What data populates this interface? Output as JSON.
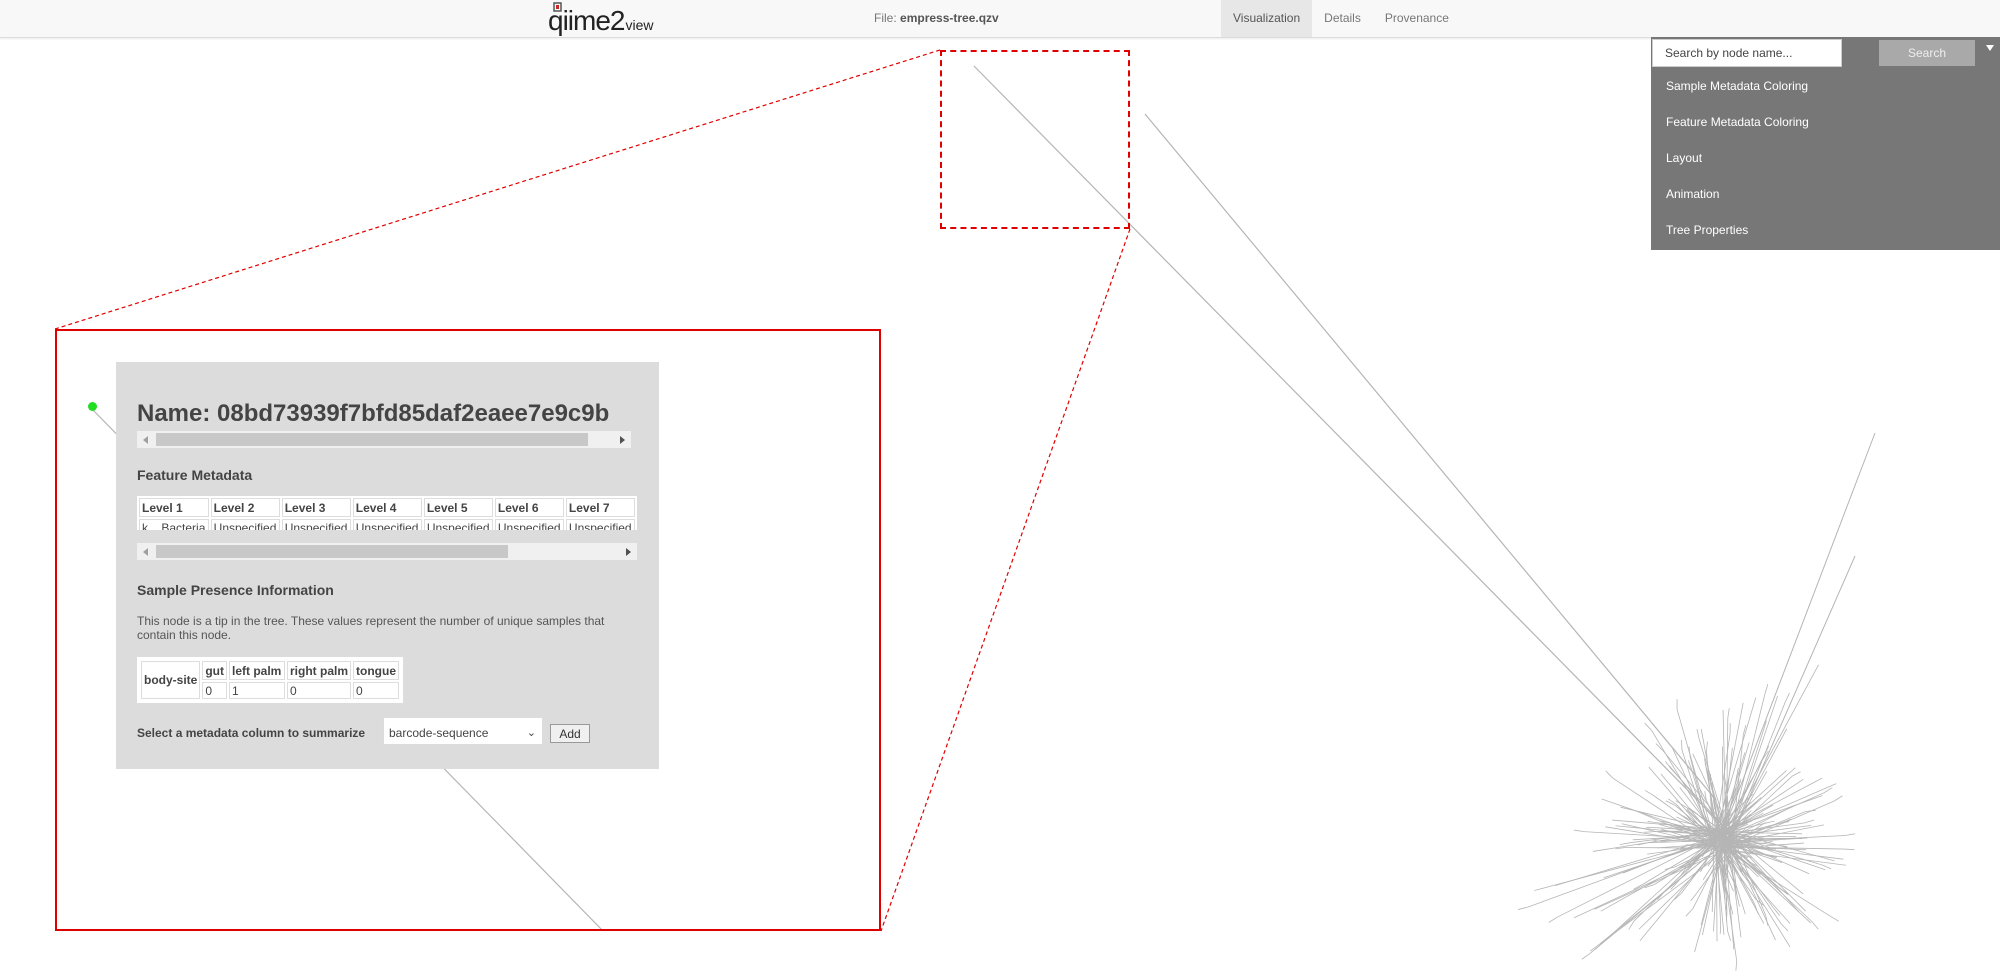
{
  "navbar": {
    "logo_main": "qiime2",
    "logo_suffix": "view",
    "file_prefix": "File:",
    "file_name": "empress-tree.qzv",
    "tabs": [
      {
        "label": "Visualization",
        "active": true
      },
      {
        "label": "Details",
        "active": false
      },
      {
        "label": "Provenance",
        "active": false
      }
    ]
  },
  "side_panel": {
    "search_placeholder": "Search by node name...",
    "search_button": "Search",
    "collapse_icon": "triangle-down-icon",
    "items": [
      "Sample Metadata Coloring",
      "Feature Metadata Coloring",
      "Layout",
      "Animation",
      "Tree Properties"
    ]
  },
  "popup": {
    "node_name": "Name: 08bd73939f7bfd85daf2eaee7e9c9b",
    "feature_metadata_title": "Feature Metadata",
    "feature_headers": [
      "Level 1",
      "Level 2",
      "Level 3",
      "Level 4",
      "Level 5",
      "Level 6",
      "Level 7"
    ],
    "feature_values": [
      "k__Bacteria",
      "Unspecified",
      "Unspecified",
      "Unspecified",
      "Unspecified",
      "Unspecified",
      "Unspecified"
    ],
    "sample_presence_title": "Sample Presence Information",
    "sample_presence_text": "This node is a tip in the tree. These values represent the number of unique samples that contain this node.",
    "sample_row_label": "body-site",
    "sample_headers": [
      "gut",
      "left palm",
      "right palm",
      "tongue"
    ],
    "sample_values": [
      "0",
      "1",
      "0",
      "0"
    ],
    "summarize_label": "Select a metadata column to summarize",
    "summarize_selected": "barcode-sequence",
    "add_button": "Add"
  },
  "colors": {
    "highlight": "#e00000",
    "node_dot": "#22dd22",
    "branch": "#b5b5b5",
    "panel": "#777777"
  }
}
